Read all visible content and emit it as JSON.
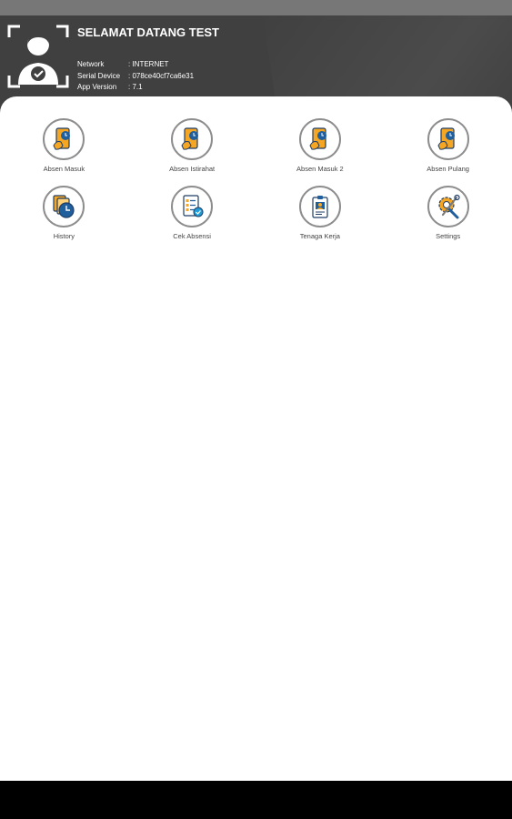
{
  "header": {
    "title": "SELAMAT DATANG TEST",
    "info": [
      {
        "key": "Network",
        "value": ": INTERNET"
      },
      {
        "key": "Serial Device",
        "value": ": 078ce40cf7ca6e31"
      },
      {
        "key": "App Version",
        "value": ": 7.1"
      }
    ]
  },
  "menu": [
    {
      "label": "Absen Masuk",
      "icon": "phone-clock-icon"
    },
    {
      "label": "Absen Istirahat",
      "icon": "phone-clock-icon"
    },
    {
      "label": "Absen Masuk 2",
      "icon": "phone-clock-icon"
    },
    {
      "label": "Absen Pulang",
      "icon": "phone-clock-icon"
    },
    {
      "label": "History",
      "icon": "history-clock-icon"
    },
    {
      "label": "Cek Absensi",
      "icon": "checklist-icon"
    },
    {
      "label": "Tenaga Kerja",
      "icon": "id-card-icon"
    },
    {
      "label": "Settings",
      "icon": "gear-tools-icon"
    }
  ],
  "colors": {
    "header_bg": "#404040",
    "status_bar": "#777777",
    "icon_orange": "#f5a623",
    "icon_blue": "#1f5f9e",
    "icon_border": "#8d8d8d"
  }
}
